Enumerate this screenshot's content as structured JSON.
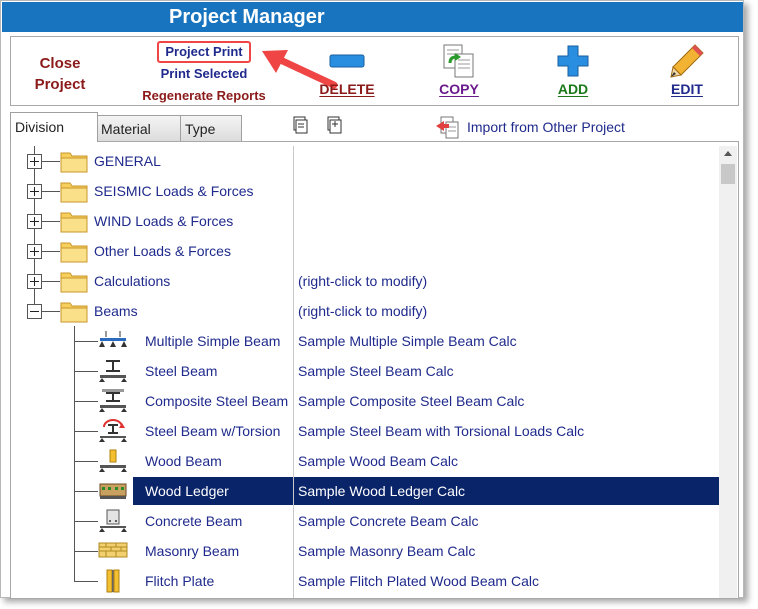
{
  "window": {
    "title": "Project Manager"
  },
  "toolbar": {
    "close_project": "Close Project",
    "project_print": "Project Print",
    "print_selected": "Print Selected",
    "regenerate_reports": "Regenerate Reports",
    "delete": "DELETE",
    "copy": "COPY",
    "add": "ADD",
    "edit": "EDIT"
  },
  "tabs": [
    "Division",
    "Material",
    "Type"
  ],
  "active_tab": "Division",
  "import_label": "Import from Other Project",
  "tree": {
    "folders": [
      {
        "name": "GENERAL",
        "desc": "",
        "expanded": false
      },
      {
        "name": "SEISMIC Loads & Forces",
        "desc": "",
        "expanded": false
      },
      {
        "name": "WIND Loads & Forces",
        "desc": "",
        "expanded": false
      },
      {
        "name": "Other Loads & Forces",
        "desc": "",
        "expanded": false
      },
      {
        "name": "Calculations",
        "desc": "(right-click to modify)",
        "expanded": false
      },
      {
        "name": "Beams",
        "desc": "(right-click to modify)",
        "expanded": true
      }
    ],
    "items": [
      {
        "name": "Multiple Simple Beam",
        "desc": "Sample Multiple Simple Beam Calc",
        "icon": "multiple-beam-icon"
      },
      {
        "name": "Steel Beam",
        "desc": "Sample Steel Beam Calc",
        "icon": "steel-beam-icon"
      },
      {
        "name": "Composite Steel Beam",
        "desc": "Sample Composite Steel Beam Calc",
        "icon": "composite-beam-icon"
      },
      {
        "name": "Steel Beam w/Torsion",
        "desc": "Sample Steel Beam with Torsional Loads Calc",
        "icon": "torsion-beam-icon"
      },
      {
        "name": "Wood Beam",
        "desc": "Sample Wood Beam Calc",
        "icon": "wood-beam-icon"
      },
      {
        "name": "Wood Ledger",
        "desc": "Sample Wood Ledger Calc",
        "icon": "wood-ledger-icon",
        "selected": true
      },
      {
        "name": "Concrete Beam",
        "desc": "Sample Concrete Beam Calc",
        "icon": "concrete-beam-icon"
      },
      {
        "name": "Masonry Beam",
        "desc": "Sample Masonry Beam Calc",
        "icon": "masonry-beam-icon"
      },
      {
        "name": "Flitch Plate",
        "desc": "Sample Flitch Plated Wood Beam Calc",
        "icon": "flitch-plate-icon"
      }
    ]
  },
  "colors": {
    "title_bar": "#1874be",
    "selection": "#0a246a",
    "link_text": "#1f2a8c",
    "highlight": "#ef4545"
  }
}
